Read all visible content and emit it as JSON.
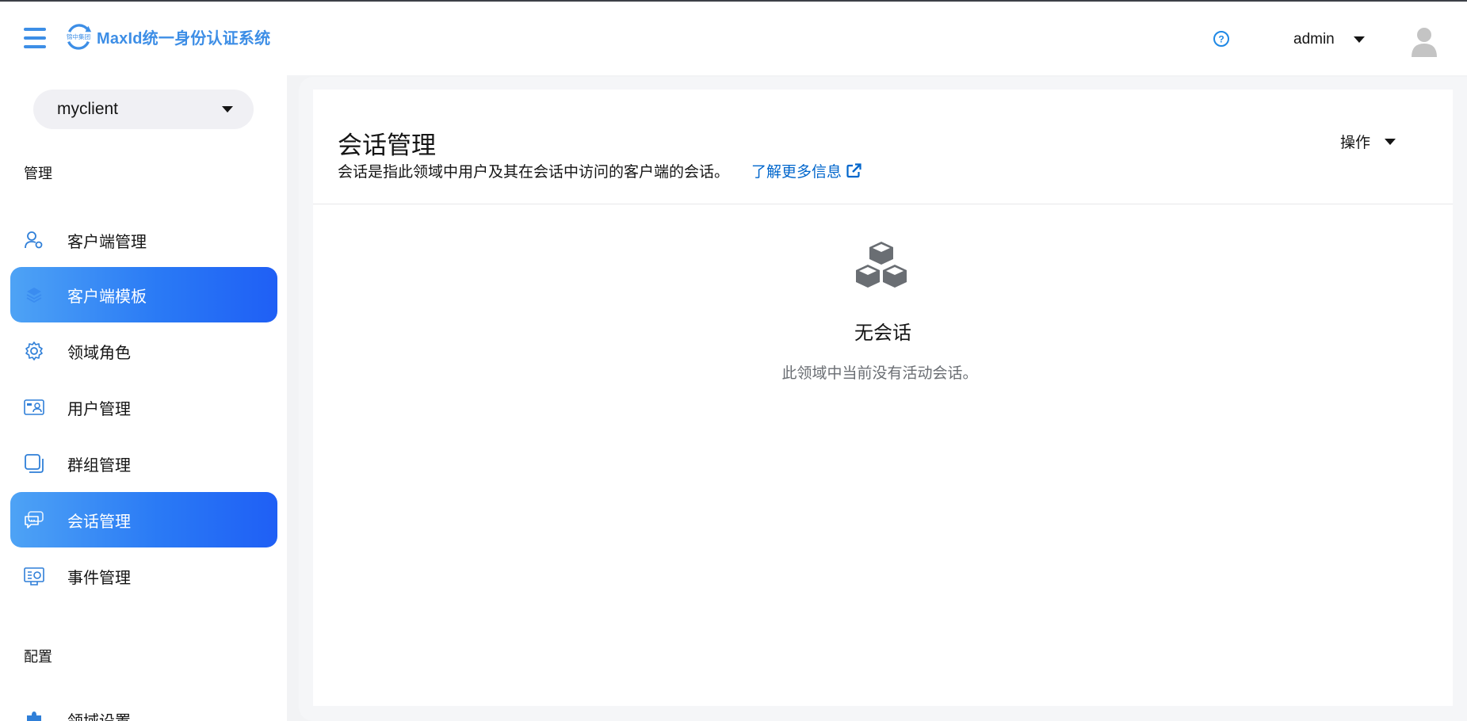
{
  "header": {
    "logo_text": "MaxId统一身份认证系统",
    "logo_mark_text": "锦中集团",
    "user_name": "admin",
    "accent_color": "#3d8ee6"
  },
  "sidebar": {
    "client_select": {
      "value": "myclient"
    },
    "sections": {
      "manage": "管理",
      "config": "配置"
    },
    "items": [
      {
        "label": "客户端管理",
        "icon": "user-shield-icon",
        "active": false
      },
      {
        "label": "客户端模板",
        "icon": "layers-icon",
        "active": true
      },
      {
        "label": "领域角色",
        "icon": "gear-icon",
        "active": false
      },
      {
        "label": "用户管理",
        "icon": "id-card-icon",
        "active": false
      },
      {
        "label": "群组管理",
        "icon": "group-square-icon",
        "active": false
      },
      {
        "label": "会话管理",
        "icon": "chat-bubbles-icon",
        "active": true
      },
      {
        "label": "事件管理",
        "icon": "event-log-icon",
        "active": false
      },
      {
        "label": "领域设置",
        "icon": "puzzle-icon",
        "active": false
      }
    ]
  },
  "main": {
    "title": "会话管理",
    "description": "会话是指此领域中用户及其在会话中访问的客户端的会话。",
    "learn_more": "了解更多信息",
    "actions_label": "操作",
    "empty_state": {
      "icon": "cubes-icon",
      "title": "无会话",
      "description": "此领域中当前没有活动会话。"
    }
  }
}
